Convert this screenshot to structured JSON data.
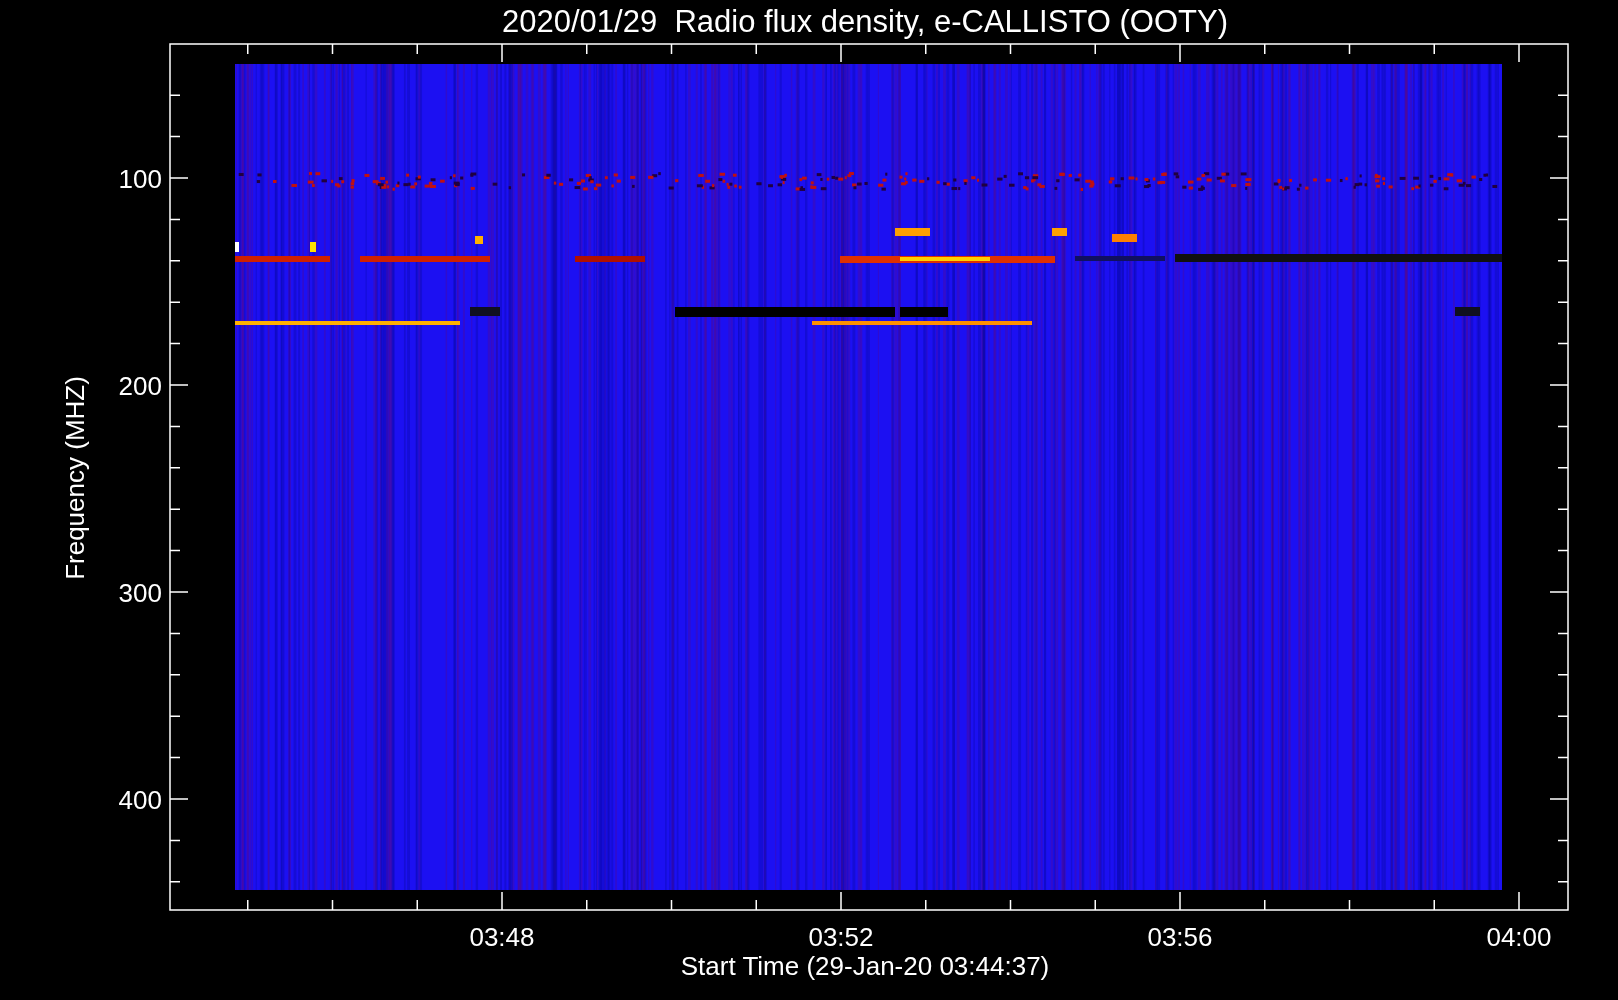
{
  "title": "2020/01/29  Radio flux density, e-CALLISTO (OOTY)",
  "plot": {
    "ylabel": "Frequency (MHZ)",
    "xlabel": "Start Time (29-Jan-20 03:44:37)",
    "y_ticks": [
      {
        "label": "100"
      },
      {
        "label": "200"
      },
      {
        "label": "300"
      },
      {
        "label": "400"
      }
    ],
    "x_ticks": [
      {
        "label": "03:48"
      },
      {
        "label": "03:52"
      },
      {
        "label": "03:56"
      },
      {
        "label": "04:00"
      }
    ]
  }
}
